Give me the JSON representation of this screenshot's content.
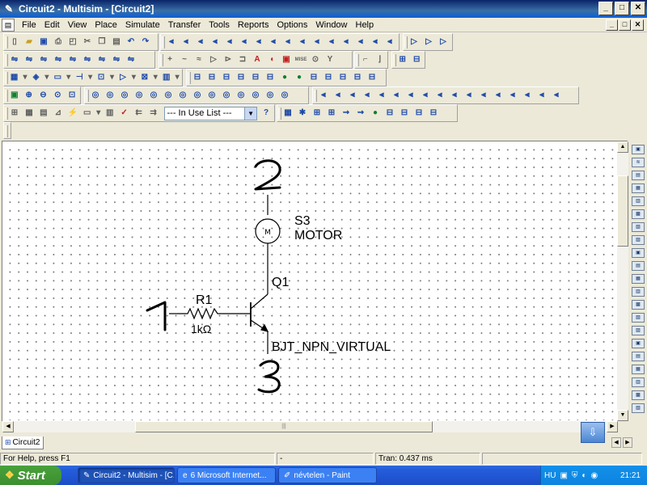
{
  "window": {
    "title": "Circuit2 - Multisim - [Circuit2]",
    "buttons": {
      "minimize": "_",
      "maximize": "□",
      "close": "✕"
    }
  },
  "menu": [
    "File",
    "Edit",
    "View",
    "Place",
    "Simulate",
    "Transfer",
    "Tools",
    "Reports",
    "Options",
    "Window",
    "Help"
  ],
  "toolbar": {
    "in_use_list": "--- In Use List ---",
    "help_icon": "?"
  },
  "schematic": {
    "net_labels": [
      "2",
      "1",
      "3"
    ],
    "motor": {
      "ref": "S3",
      "value": "MOTOR",
      "symbol": "M"
    },
    "resistor": {
      "ref": "R1",
      "value": "1kΩ"
    },
    "transistor": {
      "ref": "Q1",
      "value": "BJT_NPN_VIRTUAL"
    }
  },
  "tabs": [
    "Circuit2"
  ],
  "status": {
    "help": "For Help, press F1",
    "middle": "-",
    "tran": "Tran: 0.437 ms"
  },
  "taskbar": {
    "start": "Start",
    "tasks": [
      "Circuit2 - Multisim - [C...",
      "6 Microsoft Internet...",
      "névtelen - Paint"
    ],
    "lang": "HU",
    "clock": "21:21"
  },
  "colors": {
    "title_bar": "#0a246a",
    "taskbar": "#245edc",
    "start": "#3c8f2f",
    "canvas": "#ffffff"
  }
}
